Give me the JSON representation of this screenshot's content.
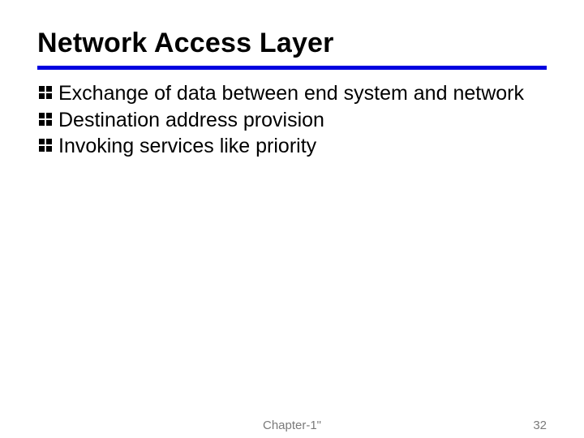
{
  "title": "Network Access Layer",
  "bullets": [
    "Exchange of data between end system and network",
    "Destination address provision",
    "Invoking services like priority"
  ],
  "footer": {
    "center": "Chapter-1\"",
    "page": "32"
  }
}
